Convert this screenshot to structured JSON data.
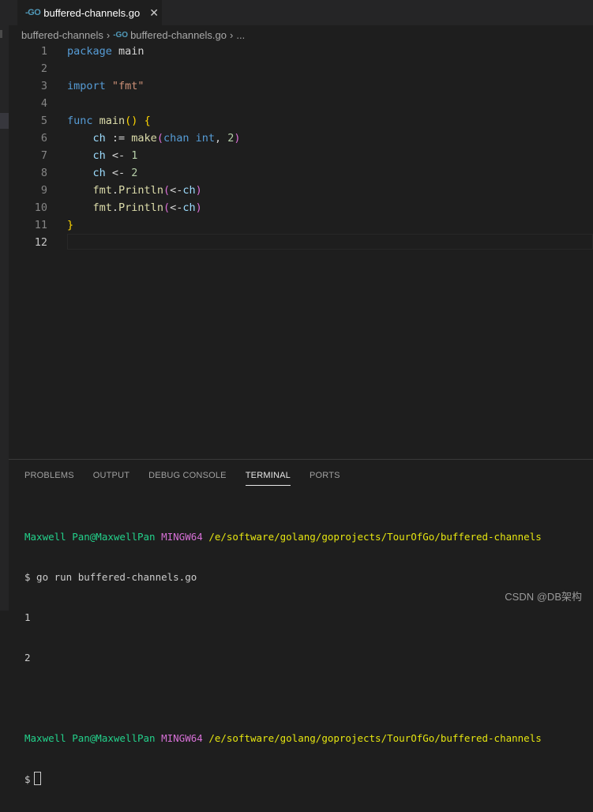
{
  "tab": {
    "icon": "go-icon",
    "label": "buffered-channels.go",
    "close": "✕"
  },
  "breadcrumb": {
    "folder": "buffered-channels",
    "file": "buffered-channels.go",
    "more": "..."
  },
  "editor": {
    "lines": [
      {
        "num": "1",
        "tokens": [
          [
            "kw",
            "package"
          ],
          [
            "plain",
            " main"
          ]
        ]
      },
      {
        "num": "2",
        "tokens": []
      },
      {
        "num": "3",
        "tokens": [
          [
            "kw",
            "import"
          ],
          [
            "plain",
            " "
          ],
          [
            "str",
            "\"fmt\""
          ]
        ]
      },
      {
        "num": "4",
        "tokens": []
      },
      {
        "num": "5",
        "tokens": [
          [
            "kw",
            "func"
          ],
          [
            "plain",
            " "
          ],
          [
            "fn",
            "main"
          ],
          [
            "br1",
            "()"
          ],
          [
            "plain",
            " "
          ],
          [
            "br1",
            "{"
          ]
        ]
      },
      {
        "num": "6",
        "tokens": [
          [
            "plain",
            "    "
          ],
          [
            "var",
            "ch"
          ],
          [
            "plain",
            " := "
          ],
          [
            "fn",
            "make"
          ],
          [
            "br2",
            "("
          ],
          [
            "kw",
            "chan"
          ],
          [
            "plain",
            " "
          ],
          [
            "kw",
            "int"
          ],
          [
            "plain",
            ", "
          ],
          [
            "num",
            "2"
          ],
          [
            "br2",
            ")"
          ]
        ]
      },
      {
        "num": "7",
        "tokens": [
          [
            "plain",
            "    "
          ],
          [
            "var",
            "ch"
          ],
          [
            "plain",
            " <- "
          ],
          [
            "num",
            "1"
          ]
        ]
      },
      {
        "num": "8",
        "tokens": [
          [
            "plain",
            "    "
          ],
          [
            "var",
            "ch"
          ],
          [
            "plain",
            " <- "
          ],
          [
            "num",
            "2"
          ]
        ]
      },
      {
        "num": "9",
        "tokens": [
          [
            "plain",
            "    "
          ],
          [
            "fn",
            "fmt"
          ],
          [
            "plain",
            "."
          ],
          [
            "fn",
            "Println"
          ],
          [
            "br2",
            "("
          ],
          [
            "plain",
            "<-"
          ],
          [
            "var",
            "ch"
          ],
          [
            "br2",
            ")"
          ]
        ]
      },
      {
        "num": "10",
        "tokens": [
          [
            "plain",
            "    "
          ],
          [
            "fn",
            "fmt"
          ],
          [
            "plain",
            "."
          ],
          [
            "fn",
            "Println"
          ],
          [
            "br2",
            "("
          ],
          [
            "plain",
            "<-"
          ],
          [
            "var",
            "ch"
          ],
          [
            "br2",
            ")"
          ]
        ]
      },
      {
        "num": "11",
        "tokens": [
          [
            "br1",
            "}"
          ]
        ]
      },
      {
        "num": "12",
        "tokens": []
      }
    ]
  },
  "panel": {
    "tabs": [
      "PROBLEMS",
      "OUTPUT",
      "DEBUG CONSOLE",
      "TERMINAL",
      "PORTS"
    ],
    "active_tab": "TERMINAL",
    "terminal": {
      "user1": "Maxwell Pan@MaxwellPan",
      "shell1": "MINGW64",
      "path1": "/e/software/golang/goprojects/TourOfGo/buffered-channels",
      "cmd": "$ go run buffered-channels.go",
      "out1": "1",
      "out2": "2",
      "user2": "Maxwell Pan@MaxwellPan",
      "shell2": "MINGW64",
      "path2": "/e/software/golang/goprojects/TourOfGo/buffered-channels",
      "prompt": "$"
    }
  },
  "watermark": "CSDN @DB架构"
}
